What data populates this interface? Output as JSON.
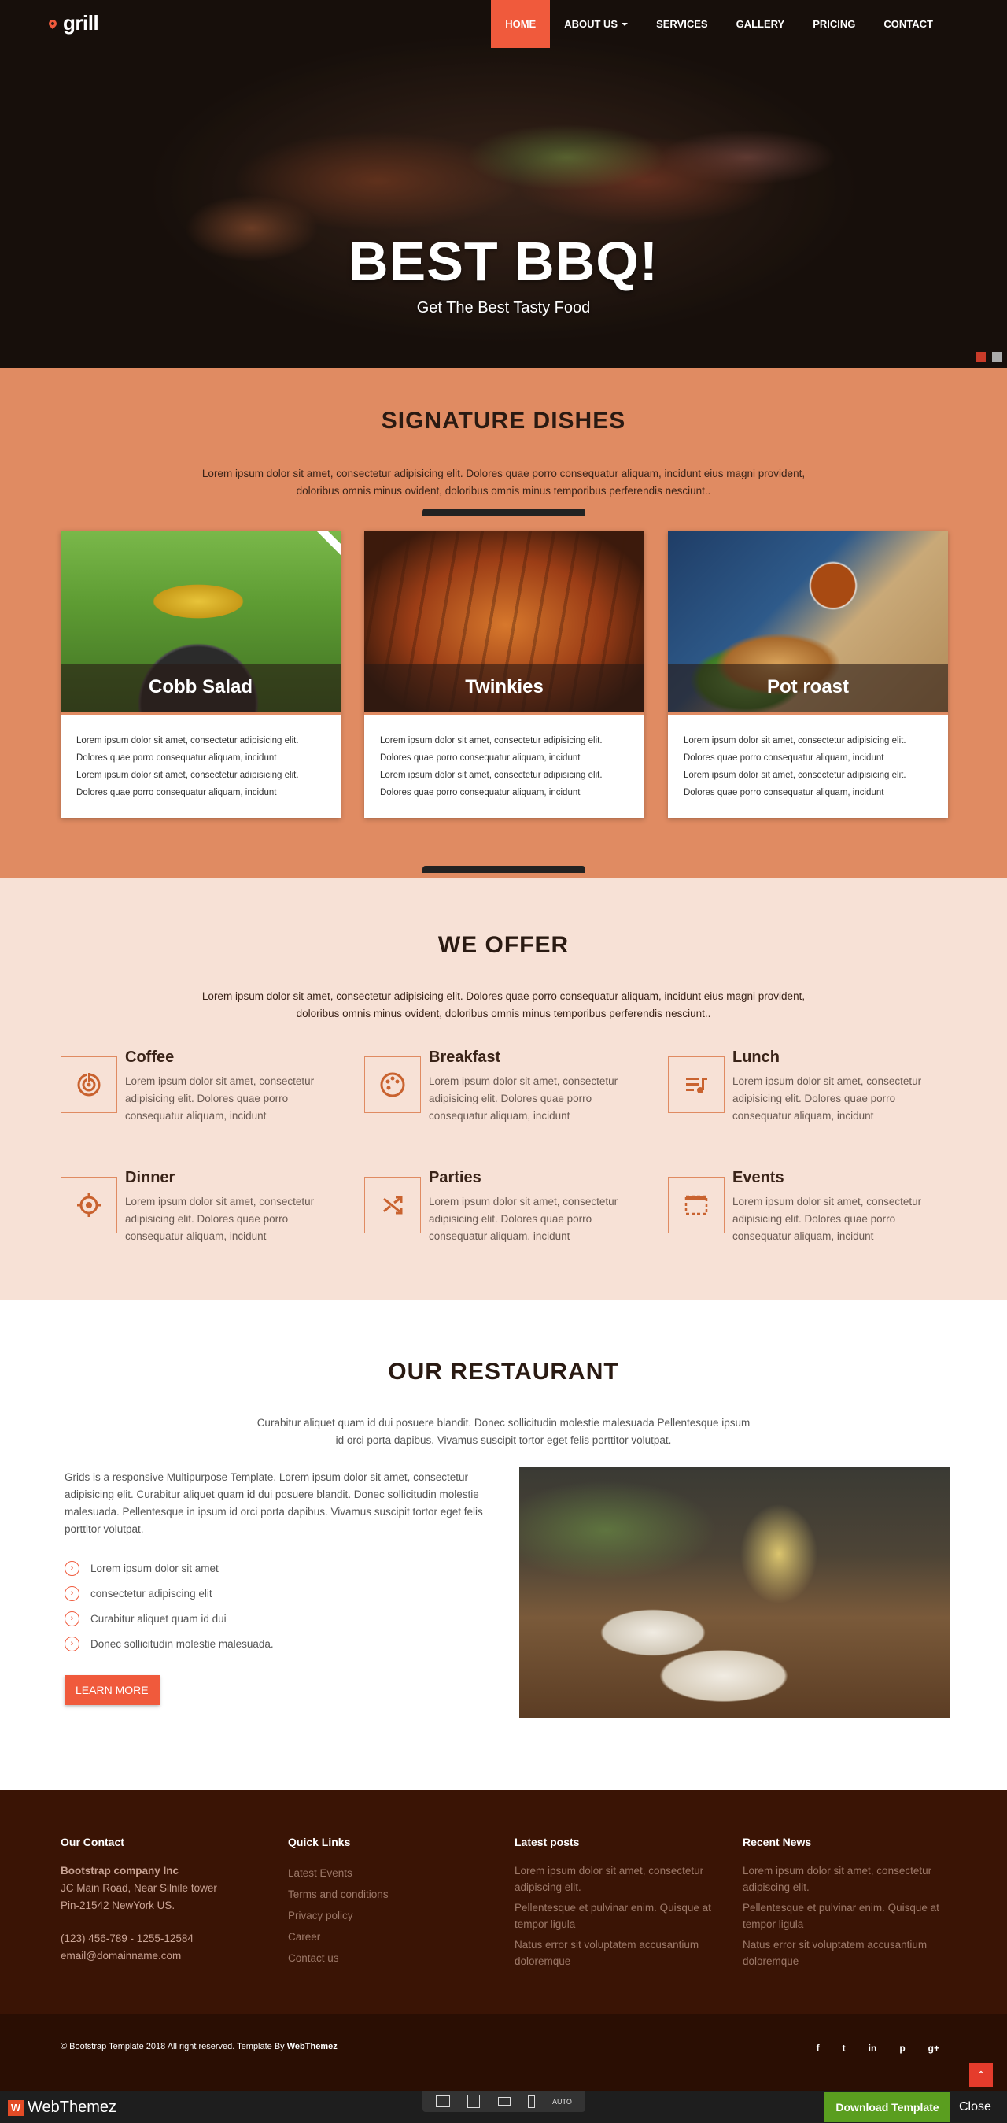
{
  "brand": {
    "name": "grill"
  },
  "nav": {
    "items": [
      {
        "label": "HOME",
        "active": true
      },
      {
        "label": "ABOUT US",
        "dropdown": true
      },
      {
        "label": "SERVICES"
      },
      {
        "label": "GALLERY"
      },
      {
        "label": "PRICING"
      },
      {
        "label": "CONTACT"
      }
    ]
  },
  "hero": {
    "title": "BEST BBQ!",
    "subtitle": "Get The Best Tasty Food",
    "slides": 2,
    "active_slide": 1
  },
  "signature": {
    "title": "SIGNATURE DISHES",
    "description": "Lorem ipsum dolor sit amet, consectetur adipisicing elit. Dolores quae porro consequatur aliquam, incidunt eius magni provident, doloribus omnis minus ovident, doloribus omnis minus temporibus perferendis nesciunt..",
    "dishes": [
      {
        "name": "Cobb Salad",
        "lines": [
          "Lorem ipsum dolor sit amet, consectetur adipisicing elit.",
          "Dolores quae porro consequatur aliquam, incidunt",
          "Lorem ipsum dolor sit amet, consectetur adipisicing elit.",
          "Dolores quae porro consequatur aliquam, incidunt"
        ]
      },
      {
        "name": "Twinkies",
        "lines": [
          "Lorem ipsum dolor sit amet, consectetur adipisicing elit.",
          "Dolores quae porro consequatur aliquam, incidunt",
          "Lorem ipsum dolor sit amet, consectetur adipisicing elit.",
          "Dolores quae porro consequatur aliquam, incidunt"
        ]
      },
      {
        "name": "Pot roast",
        "lines": [
          "Lorem ipsum dolor sit amet, consectetur adipisicing elit.",
          "Dolores quae porro consequatur aliquam, incidunt",
          "Lorem ipsum dolor sit amet, consectetur adipisicing elit.",
          "Dolores quae porro consequatur aliquam, incidunt"
        ]
      }
    ]
  },
  "offer": {
    "title": "WE OFFER",
    "description": "Lorem ipsum dolor sit amet, consectetur adipisicing elit. Dolores quae porro consequatur aliquam, incidunt eius magni provident, doloribus omnis minus ovident, doloribus omnis minus temporibus perferendis nesciunt..",
    "items": [
      {
        "name": "Coffee",
        "icon": "coffee-target-icon",
        "text": "Lorem ipsum dolor sit amet, consectetur adipisicing elit. Dolores quae porro consequatur aliquam, incidunt"
      },
      {
        "name": "Breakfast",
        "icon": "palette-icon",
        "text": "Lorem ipsum dolor sit amet, consectetur adipisicing elit. Dolores quae porro consequatur aliquam, incidunt"
      },
      {
        "name": "Lunch",
        "icon": "music-list-icon",
        "text": "Lorem ipsum dolor sit amet, consectetur adipisicing elit. Dolores quae porro consequatur aliquam, incidunt"
      },
      {
        "name": "Dinner",
        "icon": "crosshair-icon",
        "text": "Lorem ipsum dolor sit amet, consectetur adipisicing elit. Dolores quae porro consequatur aliquam, incidunt"
      },
      {
        "name": "Parties",
        "icon": "shuffle-icon",
        "text": "Lorem ipsum dolor sit amet, consectetur adipisicing elit. Dolores quae porro consequatur aliquam, incidunt"
      },
      {
        "name": "Events",
        "icon": "calendar-frame-icon",
        "text": "Lorem ipsum dolor sit amet, consectetur adipisicing elit. Dolores quae porro consequatur aliquam, incidunt"
      }
    ]
  },
  "restaurant": {
    "title": "OUR RESTAURANT",
    "description": "Curabitur aliquet quam id dui posuere blandit. Donec sollicitudin molestie malesuada Pellentesque ipsum id orci porta dapibus. Vivamus suscipit tortor eget felis porttitor volutpat.",
    "paragraph": "Grids is a responsive Multipurpose Template. Lorem ipsum dolor sit amet, consectetur adipisicing elit. Curabitur aliquet quam id dui posuere blandit. Donec sollicitudin molestie malesuada. Pellentesque in ipsum id orci porta dapibus. Vivamus suscipit tortor eget felis porttitor volutpat.",
    "list": [
      "Lorem ipsum dolor sit amet",
      "consectetur adipiscing elit",
      "Curabitur aliquet quam id dui",
      "Donec sollicitudin molestie malesuada."
    ],
    "button": "LEARN MORE"
  },
  "footer": {
    "contact": {
      "heading": "Our Contact",
      "company": "Bootstrap company Inc",
      "address1": "JC Main Road, Near Silnile tower",
      "address2": "Pin-21542 NewYork US.",
      "phone": "(123) 456-789 - 1255-12584",
      "email": "email@domainname.com"
    },
    "quick_links": {
      "heading": "Quick Links",
      "links": [
        "Latest Events",
        "Terms and conditions",
        "Privacy policy",
        "Career",
        "Contact us"
      ]
    },
    "latest_posts": {
      "heading": "Latest posts",
      "posts": [
        "Lorem ipsum dolor sit amet, consectetur adipiscing elit.",
        "Pellentesque et pulvinar enim. Quisque at tempor ligula",
        "Natus error sit voluptatem accusantium doloremque"
      ]
    },
    "recent_news": {
      "heading": "Recent News",
      "posts": [
        "Lorem ipsum dolor sit amet, consectetur adipiscing elit.",
        "Pellentesque et pulvinar enim. Quisque at tempor ligula",
        "Natus error sit voluptatem accusantium doloremque"
      ]
    },
    "copyright_prefix": "© Bootstrap Template 2018 All right reserved. Template By ",
    "copyright_brand": "WebThemez",
    "socials": [
      "f",
      "t",
      "in",
      "p",
      "g+"
    ]
  },
  "webthemez_bar": {
    "badge": "W",
    "name": "WebThemez",
    "auto": "AUTO",
    "download": "Download Template",
    "close": "Close"
  },
  "colors": {
    "accent": "#f05a3c",
    "signature_bg": "#e08b62",
    "offer_bg": "#f7e1d6",
    "footer_bg": "#3a1405"
  }
}
